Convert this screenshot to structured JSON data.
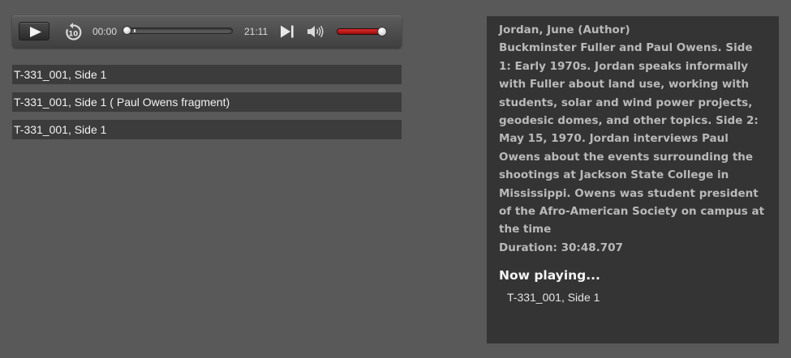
{
  "player": {
    "current_time": "00:00",
    "total_time": "21:11",
    "progress": 0.0,
    "volume": 0.8,
    "accent_color": "#c41d1d",
    "icons": {
      "play": "play-icon",
      "rewind": "rewind-10-icon",
      "next": "skip-next-icon",
      "volume": "volume-icon"
    },
    "rewind_label": "10"
  },
  "playlist": {
    "tracks": [
      {
        "label": "T-331_001, Side 1"
      },
      {
        "label": "T-331_001, Side 1 ( Paul Owens fragment)"
      },
      {
        "label": "T-331_001, Side 1"
      }
    ]
  },
  "info": {
    "author": "Jordan, June (Author)",
    "description": "Buckminster Fuller and Paul Owens. Side 1: Early 1970s. Jordan speaks informally with Fuller about land use, working with students, solar and wind power projects, geodesic domes, and other topics. Side 2: May 15, 1970. Jordan interviews Paul Owens about the events surrounding the shootings at Jackson State College in Mississippi. Owens was student president of the Afro-American Society on campus at the time",
    "duration": "Duration: 30:48.707",
    "now_playing_heading": "Now playing...",
    "now_playing_track": "T-331_001, Side 1"
  }
}
